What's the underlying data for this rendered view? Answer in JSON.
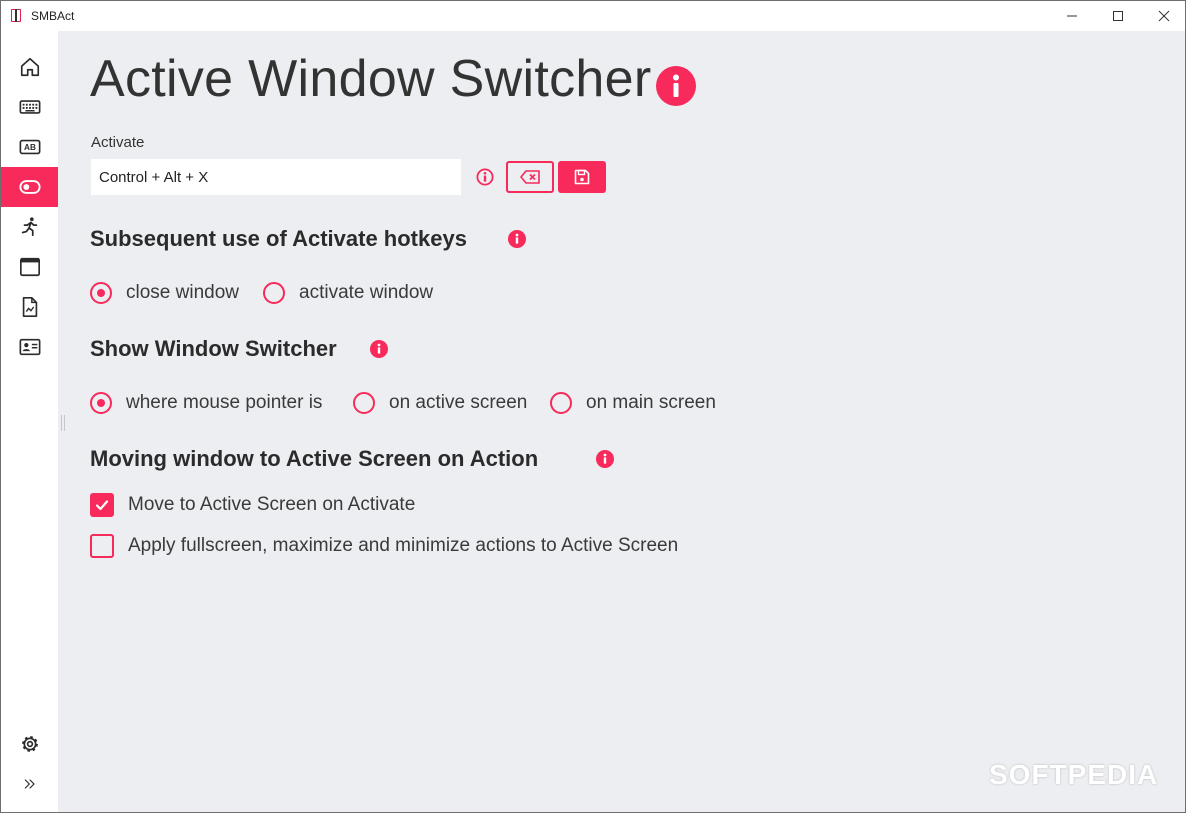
{
  "window": {
    "title": "SMBAct",
    "controls": {
      "minimize": "minimize-icon",
      "maximize": "maximize-icon",
      "close": "close-icon"
    }
  },
  "sidebar": {
    "items": [
      {
        "icon": "home-icon",
        "active": false
      },
      {
        "icon": "keyboard-icon",
        "active": false
      },
      {
        "icon": "text-ab-icon",
        "label": "AB",
        "active": false
      },
      {
        "icon": "toggle-icon",
        "active": true
      },
      {
        "icon": "running-person-icon",
        "active": false
      },
      {
        "icon": "window-icon",
        "active": false
      },
      {
        "icon": "document-chart-icon",
        "active": false
      },
      {
        "icon": "id-card-icon",
        "active": false
      }
    ],
    "bottom": [
      {
        "icon": "gear-icon"
      },
      {
        "icon": "expand-chevrons-icon"
      }
    ]
  },
  "main": {
    "title": "Active Window Switcher",
    "activate": {
      "label": "Activate",
      "value": "Control + Alt + X"
    },
    "subsequent": {
      "heading": "Subsequent use of Activate hotkeys",
      "options": [
        {
          "label": "close window",
          "selected": true
        },
        {
          "label": "activate window",
          "selected": false
        }
      ]
    },
    "show_switcher": {
      "heading": "Show Window Switcher",
      "options": [
        {
          "label": "where mouse pointer is",
          "selected": true
        },
        {
          "label": "on active screen",
          "selected": false
        },
        {
          "label": "on main screen",
          "selected": false
        }
      ]
    },
    "moving": {
      "heading": "Moving window to Active Screen on Action",
      "checkboxes": [
        {
          "label": "Move to Active Screen on Activate",
          "checked": true
        },
        {
          "label": "Apply fullscreen, maximize and minimize actions to Active Screen",
          "checked": false
        }
      ]
    }
  },
  "watermark": "SOFTPEDIA",
  "colors": {
    "accent": "#f72a5b",
    "background": "#eceef1",
    "sidebar": "#ffffff"
  }
}
